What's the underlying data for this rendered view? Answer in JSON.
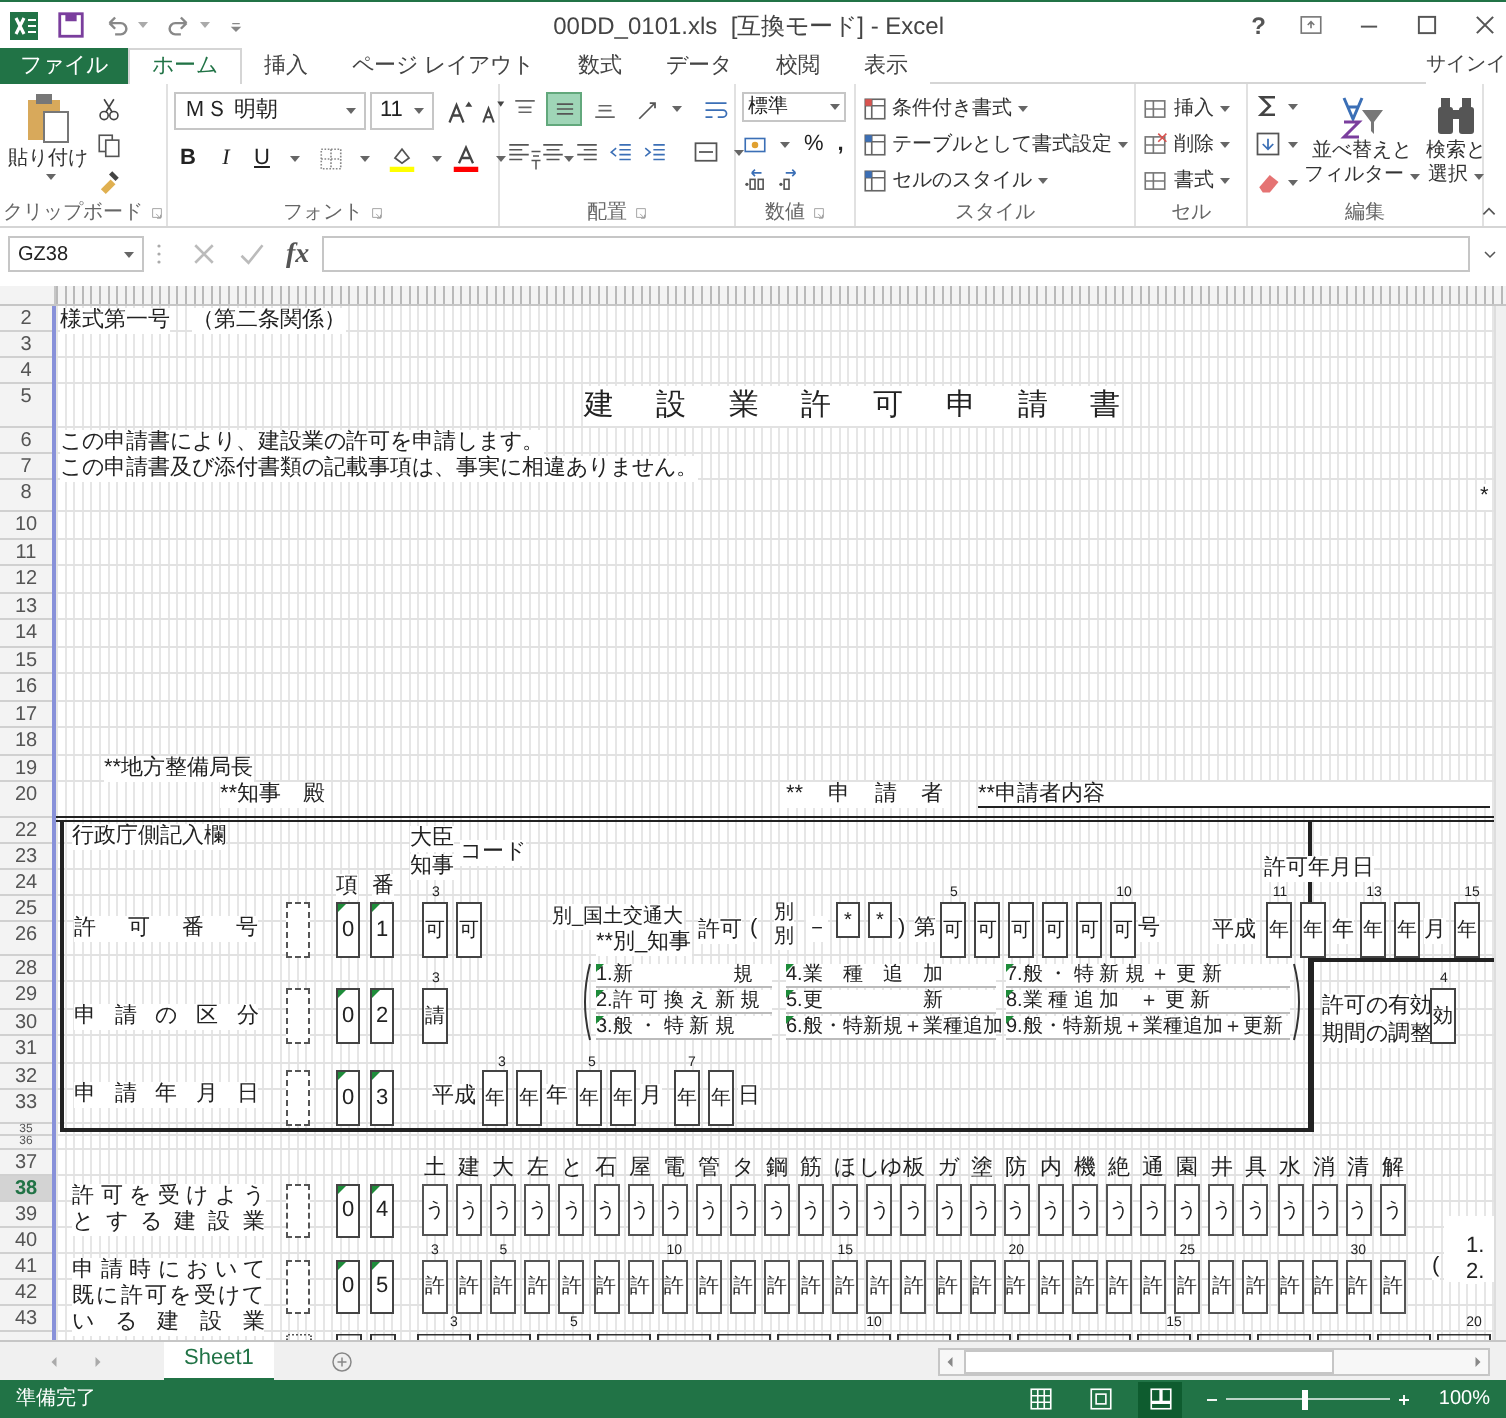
{
  "window": {
    "title": "00DD_0101.xls  [互換モード] - Excel",
    "help": "?"
  },
  "ribbon_tabs": [
    {
      "label": "ファイル",
      "kind": "file",
      "selected": false
    },
    {
      "label": "ホーム",
      "kind": "tab",
      "selected": true
    },
    {
      "label": "挿入",
      "kind": "tab",
      "selected": false
    },
    {
      "label": "ページ レイアウト",
      "kind": "tab",
      "selected": false
    },
    {
      "label": "数式",
      "kind": "tab",
      "selected": false
    },
    {
      "label": "データ",
      "kind": "tab",
      "selected": false
    },
    {
      "label": "校閲",
      "kind": "tab",
      "selected": false
    },
    {
      "label": "表示",
      "kind": "tab",
      "selected": false
    }
  ],
  "account": "サインイ",
  "clipboard": {
    "paste": "貼り付け",
    "label": "クリップボード"
  },
  "font": {
    "name": "ＭＳ 明朝",
    "size": "11",
    "bold": "B",
    "italic": "I",
    "underline": "U",
    "label": "フォント"
  },
  "alignment": {
    "label": "配置",
    "vertical": [
      {
        "selected": false
      },
      {
        "selected": true
      },
      {
        "selected": false
      }
    ]
  },
  "number": {
    "format": "標準",
    "percent": "%",
    "comma": ",",
    "label": "数値"
  },
  "styles": {
    "commands": [
      "条件付き書式",
      "テーブルとして書式設定",
      "セルのスタイル"
    ],
    "label": "スタイル"
  },
  "cells": {
    "commands": [
      "挿入",
      "削除",
      "書式"
    ],
    "label": "セル"
  },
  "editing": {
    "sort": [
      "並べ替えと",
      "フィルター"
    ],
    "find": [
      "検索と",
      "選択"
    ],
    "label": "編集"
  },
  "formula_bar": {
    "name_box": "GZ38",
    "function_label": "fx"
  },
  "sheet": {
    "rows": [
      {
        "label": "2",
        "selected": false
      },
      {
        "label": "3",
        "selected": false
      },
      {
        "label": "4",
        "selected": false
      },
      {
        "label": "5",
        "selected": false
      },
      {
        "label": "6",
        "selected": false
      },
      {
        "label": "7",
        "selected": false
      },
      {
        "label": "8",
        "selected": false
      },
      {
        "label": "10",
        "selected": false
      },
      {
        "label": "11",
        "selected": false
      },
      {
        "label": "12",
        "selected": false
      },
      {
        "label": "13",
        "selected": false
      },
      {
        "label": "14",
        "selected": false
      },
      {
        "label": "15",
        "selected": false
      },
      {
        "label": "16",
        "selected": false
      },
      {
        "label": "17",
        "selected": false
      },
      {
        "label": "18",
        "selected": false
      },
      {
        "label": "19",
        "selected": false
      },
      {
        "label": "20",
        "selected": false
      },
      {
        "label": "22",
        "selected": false
      },
      {
        "label": "23",
        "selected": false
      },
      {
        "label": "24",
        "selected": false
      },
      {
        "label": "25",
        "selected": false
      },
      {
        "label": "26",
        "selected": false
      },
      {
        "label": "28",
        "selected": false
      },
      {
        "label": "29",
        "selected": false
      },
      {
        "label": "30",
        "selected": false
      },
      {
        "label": "31",
        "selected": false
      },
      {
        "label": "32",
        "selected": false
      },
      {
        "label": "33",
        "selected": false
      },
      {
        "label": "35",
        "selected": false
      },
      {
        "label": "36",
        "selected": false
      },
      {
        "label": "37",
        "selected": false
      },
      {
        "label": "38",
        "selected": true
      },
      {
        "label": "39",
        "selected": false
      },
      {
        "label": "40",
        "selected": false
      },
      {
        "label": "41",
        "selected": false
      },
      {
        "label": "42",
        "selected": false
      },
      {
        "label": "43",
        "selected": false
      }
    ],
    "items": [
      {
        "text": "様式第一号",
        "kind": "heading"
      },
      {
        "text": "（第二条関係）",
        "kind": "text"
      },
      {
        "text": "建 設 業 許 可 申 請 書",
        "kind": "title"
      },
      {
        "text": "この申請書により、建設業の許可を申請します。",
        "kind": "text"
      },
      {
        "text": "この申請書及び添付書類の記載事項は、事実に相違ありません。",
        "kind": "text"
      },
      {
        "text": "*",
        "kind": "text"
      },
      {
        "text": "**地方整備局長",
        "kind": "text"
      },
      {
        "text": "**知事　殿",
        "kind": "text"
      },
      {
        "text": "** 申 請 者",
        "kind": "label"
      },
      {
        "text": "**申請者内容",
        "kind": "underlined"
      },
      {
        "text": "行政庁側記入欄",
        "kind": "text"
      },
      {
        "text": "大臣",
        "kind": "text"
      },
      {
        "text": "知事",
        "kind": "text"
      },
      {
        "text": "コード",
        "kind": "text"
      },
      {
        "text": "項",
        "kind": "text"
      },
      {
        "text": "番",
        "kind": "text"
      },
      {
        "text": "許可年月日",
        "kind": "text"
      },
      {
        "text": "許 可 番 号",
        "kind": "label"
      },
      {
        "kind": "dotted"
      },
      {
        "text": "0",
        "kind": "code"
      },
      {
        "text": "1",
        "kind": "code"
      },
      {
        "text": "3",
        "kind": "tick"
      },
      {
        "text": "可",
        "kind": "box"
      },
      {
        "text": "可",
        "kind": "box"
      },
      {
        "text": "別_国土交通大",
        "kind": "text"
      },
      {
        "text": "**別_知事",
        "kind": "text"
      },
      {
        "text": "許可",
        "kind": "text"
      },
      {
        "text": "(",
        "kind": "text"
      },
      {
        "text": "別",
        "kind": "small"
      },
      {
        "text": "別",
        "kind": "small"
      },
      {
        "text": "－",
        "kind": "text"
      },
      {
        "text": "*",
        "kind": "box"
      },
      {
        "text": "*",
        "kind": "box"
      },
      {
        "text": ")",
        "kind": "text"
      },
      {
        "text": "第",
        "kind": "text"
      },
      {
        "text": "可",
        "kind": "box"
      },
      {
        "text": "可",
        "kind": "box"
      },
      {
        "text": "可",
        "kind": "box"
      },
      {
        "text": "可",
        "kind": "box"
      },
      {
        "text": "可",
        "kind": "box"
      },
      {
        "text": "可",
        "kind": "box"
      },
      {
        "text": "号",
        "kind": "text"
      },
      {
        "text": "5",
        "kind": "tick"
      },
      {
        "text": "10",
        "kind": "tick"
      },
      {
        "text": "平成",
        "kind": "text"
      },
      {
        "text": "年",
        "kind": "box"
      },
      {
        "text": "年",
        "kind": "box"
      },
      {
        "text": "年",
        "kind": "text"
      },
      {
        "text": "年",
        "kind": "box"
      },
      {
        "text": "年",
        "kind": "box"
      },
      {
        "text": "月",
        "kind": "text"
      },
      {
        "text": "年",
        "kind": "box"
      },
      {
        "text": "11",
        "kind": "tick"
      },
      {
        "text": "13",
        "kind": "tick"
      },
      {
        "text": "15",
        "kind": "tick"
      },
      {
        "text": "申 請 の 区 分",
        "kind": "label"
      },
      {
        "kind": "dotted"
      },
      {
        "text": "0",
        "kind": "code"
      },
      {
        "text": "2",
        "kind": "code"
      },
      {
        "text": "3",
        "kind": "tick"
      },
      {
        "text": "請",
        "kind": "box"
      },
      {
        "text": "許可の有効",
        "kind": "text"
      },
      {
        "text": "期間の調整",
        "kind": "text"
      },
      {
        "text": "4",
        "kind": "tick"
      },
      {
        "text": "効",
        "kind": "box"
      },
      {
        "text": "申 請 年 月 日",
        "kind": "label"
      },
      {
        "kind": "dotted"
      },
      {
        "text": "0",
        "kind": "code"
      },
      {
        "text": "3",
        "kind": "code"
      },
      {
        "text": "平成",
        "kind": "text"
      },
      {
        "text": "年",
        "kind": "box"
      },
      {
        "text": "年",
        "kind": "box"
      },
      {
        "text": "年",
        "kind": "text"
      },
      {
        "text": "年",
        "kind": "box"
      },
      {
        "text": "年",
        "kind": "box"
      },
      {
        "text": "月",
        "kind": "text"
      },
      {
        "text": "年",
        "kind": "box"
      },
      {
        "text": "年",
        "kind": "box"
      },
      {
        "text": "日",
        "kind": "text"
      },
      {
        "text": "3",
        "kind": "tick"
      },
      {
        "text": "5",
        "kind": "tick"
      },
      {
        "text": "7",
        "kind": "tick"
      },
      {
        "text": "許 可 を 受 け よ う",
        "kind": "label"
      },
      {
        "text": "と す る 建 設 業",
        "kind": "label"
      },
      {
        "kind": "dotted"
      },
      {
        "text": "0",
        "kind": "code"
      },
      {
        "text": "4",
        "kind": "code"
      },
      {
        "text": "申 請 時 に お い て",
        "kind": "label"
      },
      {
        "text": "既 に 許 可 を 受 け て",
        "kind": "label"
      },
      {
        "text": "い る 建 設 業",
        "kind": "label"
      },
      {
        "kind": "dotted"
      },
      {
        "text": "0",
        "kind": "code"
      },
      {
        "text": "5",
        "kind": "code"
      },
      {
        "text": "(",
        "kind": "text"
      },
      {
        "text": "1.",
        "kind": "text"
      },
      {
        "text": "2.",
        "kind": "text"
      },
      {
        "text": "3",
        "kind": "tick"
      },
      {
        "text": "5",
        "kind": "tick"
      },
      {
        "text": "10",
        "kind": "tick"
      },
      {
        "text": "15",
        "kind": "tick"
      },
      {
        "text": "20",
        "kind": "tick"
      }
    ],
    "application_types": [
      "1.新　　　　　規",
      "2.許 可 換 え 新 規",
      "3.般 ・ 特 新 規",
      "4.業　種　追　加",
      "5.更　　　　　新",
      "6.般・特新規＋業種追加",
      "7.般 ・ 特 新 規 ＋ 更 新",
      "8.業 種 追 加　＋ 更 新",
      "9.般・特新規＋業種追加＋更新"
    ],
    "trade_labels": [
      "土",
      "建",
      "大",
      "左",
      "と",
      "石",
      "屋",
      "電",
      "管",
      "タ",
      "鋼",
      "筋",
      "ほ",
      "しゆ",
      "板",
      "ガ",
      "塗",
      "防",
      "内",
      "機",
      "絶",
      "通",
      "園",
      "井",
      "具",
      "水",
      "消",
      "清",
      "解"
    ],
    "trade_boxes": [
      "う",
      "う",
      "う",
      "う",
      "う",
      "う",
      "う",
      "う",
      "う",
      "う",
      "う",
      "う",
      "う",
      "う",
      "う",
      "う",
      "う",
      "う",
      "う",
      "う",
      "う",
      "う",
      "う",
      "う",
      "う",
      "う",
      "う",
      "う",
      "う"
    ],
    "license_ticks": [
      "3",
      "5",
      "10",
      "15",
      "20",
      "25",
      "30"
    ],
    "license_boxes": [
      "許",
      "許",
      "許",
      "許",
      "許",
      "許",
      "許",
      "許",
      "許",
      "許",
      "許",
      "許",
      "許",
      "許",
      "許",
      "許",
      "許",
      "許",
      "許",
      "許",
      "許",
      "許",
      "許",
      "許",
      "許",
      "許",
      "許",
      "許",
      "許"
    ]
  },
  "sheet_tabs": [
    {
      "label": "Sheet1",
      "selected": true
    }
  ],
  "status_bar": {
    "text": "準備完了",
    "views": [
      {
        "kind": "normal",
        "selected": false
      },
      {
        "kind": "page_layout",
        "selected": false
      },
      {
        "kind": "page_break",
        "selected": true
      }
    ],
    "zoom_slider": {
      "level": 0.47
    },
    "zoom": "100%"
  }
}
